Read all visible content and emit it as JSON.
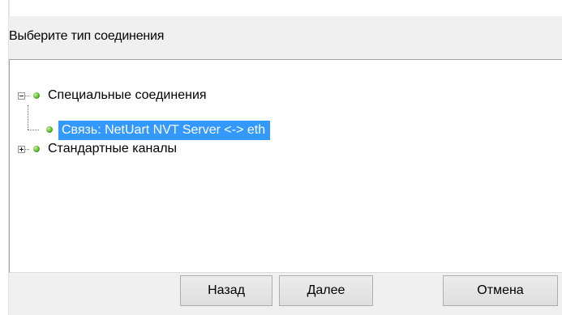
{
  "dialog": {
    "caption": "Выберите тип соединения"
  },
  "tree": {
    "nodes": [
      {
        "label": "Специальные соединения",
        "expanded": true
      },
      {
        "label": "Связь: NetUart NVT Server <-> eth",
        "selected": true
      },
      {
        "label": "Стандартные каналы",
        "expanded": false
      }
    ]
  },
  "buttons": {
    "back": "Назад",
    "next": "Далее",
    "cancel": "Отмена"
  },
  "colors": {
    "selection": "#3399ff",
    "node_dot": "#55b82a",
    "dialog_bg": "#f0f0f0"
  }
}
